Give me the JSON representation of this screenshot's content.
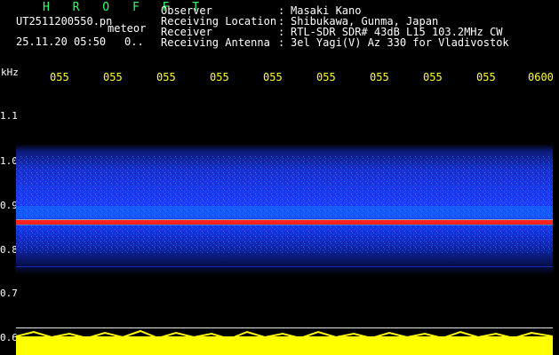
{
  "header": {
    "title": "H R O F F T",
    "filename": "UT2511200550.pn",
    "type_label": "meteor",
    "datetime": "25.11.20 05:50",
    "dots": "0..",
    "meta": [
      {
        "key": "Observer",
        "sep": ":",
        "value": "Masaki Kano"
      },
      {
        "key": "Receiving Location",
        "sep": ":",
        "value": "Shibukawa, Gunma, Japan"
      },
      {
        "key": "Receiver",
        "sep": ":",
        "value": "RTL-SDR SDR# 43dB L15 103.2MHz CW"
      },
      {
        "key": "Receiving Antenna",
        "sep": ":",
        "value": "3el Yagi(V) Az 330 for Vladivostok"
      }
    ]
  },
  "axes": {
    "y_unit": "kHz",
    "y_ticks": [
      "1.1",
      "1.0",
      "0.9",
      "0.8",
      "0.7",
      "0.6"
    ],
    "x_ticks": [
      "055",
      "055",
      "055",
      "055",
      "055",
      "055",
      "055",
      "055",
      "055",
      "0600"
    ]
  },
  "colors": {
    "background": "#000000",
    "text_green": "#33ff66",
    "text_white": "#ffffff",
    "text_yellow": "#ffff33",
    "band_blue": "#1e3cff",
    "band_cyan": "#00d0ff",
    "carrier_red": "#ff2020",
    "noise_yellow": "#ffff00"
  }
}
